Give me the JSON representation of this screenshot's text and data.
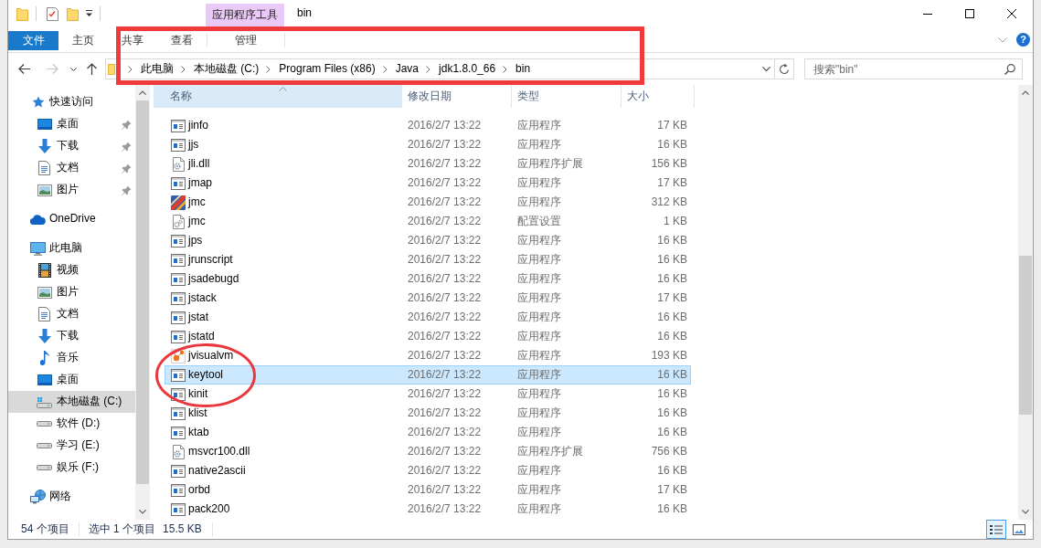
{
  "title_bar": {
    "context_tab": "应用程序工具",
    "title": "bin"
  },
  "ribbon": {
    "tabs": [
      {
        "label": "文件",
        "kind": "menu",
        "selected": false
      },
      {
        "label": "主页",
        "kind": "tab",
        "selected": false
      },
      {
        "label": "共享",
        "kind": "tab",
        "selected": false
      },
      {
        "label": "查看",
        "kind": "tab",
        "selected": false
      },
      {
        "label": "管理",
        "kind": "context",
        "selected": false
      }
    ],
    "help": "?"
  },
  "navigation": [
    {
      "kind": "back",
      "disabled": false
    },
    {
      "kind": "forward",
      "disabled": true
    },
    {
      "kind": "recent",
      "disabled": false
    },
    {
      "kind": "up",
      "disabled": false
    }
  ],
  "address_bar": {
    "crumbs": [
      "此电脑",
      "本地磁盘 (C:)",
      "Program Files (x86)",
      "Java",
      "jdk1.8.0_66",
      "bin"
    ]
  },
  "search": {
    "placeholder": "搜索\"bin\""
  },
  "sidebar": {
    "items": [
      {
        "label": "快速访问",
        "kind": "quick-access",
        "selected": false,
        "children": [
          {
            "label": "桌面",
            "kind": "desktop",
            "selected": false,
            "pinned": true
          },
          {
            "label": "下载",
            "kind": "downloads",
            "selected": false,
            "pinned": true
          },
          {
            "label": "文档",
            "kind": "documents",
            "selected": false,
            "pinned": true
          },
          {
            "label": "图片",
            "kind": "pictures",
            "selected": false,
            "pinned": true
          }
        ]
      },
      {
        "label": "OneDrive",
        "kind": "onedrive",
        "selected": false
      },
      {
        "label": "此电脑",
        "kind": "computer",
        "selected": false,
        "children": [
          {
            "label": "视频",
            "kind": "videos",
            "selected": false
          },
          {
            "label": "图片",
            "kind": "pictures",
            "selected": false
          },
          {
            "label": "文档",
            "kind": "documents",
            "selected": false
          },
          {
            "label": "下载",
            "kind": "downloads",
            "selected": false
          },
          {
            "label": "音乐",
            "kind": "music",
            "selected": false
          },
          {
            "label": "桌面",
            "kind": "desktop",
            "selected": false
          },
          {
            "label": "本地磁盘 (C:)",
            "kind": "system-drive",
            "selected": true
          },
          {
            "label": "软件 (D:)",
            "kind": "drive",
            "selected": false
          },
          {
            "label": "学习 (E:)",
            "kind": "drive",
            "selected": false
          },
          {
            "label": "娱乐 (F:)",
            "kind": "drive",
            "selected": false
          }
        ]
      },
      {
        "label": "网络",
        "kind": "network",
        "selected": false
      }
    ]
  },
  "columns": [
    {
      "label": "名称",
      "sorted": true
    },
    {
      "label": "修改日期",
      "sorted": false
    },
    {
      "label": "类型",
      "sorted": false
    },
    {
      "label": "大小",
      "sorted": false
    }
  ],
  "files": [
    {
      "name": "jinfo",
      "kind": "exe",
      "date": "2016/2/7 13:22",
      "type": "应用程序",
      "size": "17 KB",
      "selected": false
    },
    {
      "name": "jjs",
      "kind": "exe",
      "date": "2016/2/7 13:22",
      "type": "应用程序",
      "size": "16 KB",
      "selected": false
    },
    {
      "name": "jli.dll",
      "kind": "dll",
      "date": "2016/2/7 13:22",
      "type": "应用程序扩展",
      "size": "156 KB",
      "selected": false
    },
    {
      "name": "jmap",
      "kind": "exe",
      "date": "2016/2/7 13:22",
      "type": "应用程序",
      "size": "17 KB",
      "selected": false
    },
    {
      "name": "jmc",
      "kind": "jmc",
      "date": "2016/2/7 13:22",
      "type": "应用程序",
      "size": "312 KB",
      "selected": false
    },
    {
      "name": "jmc",
      "kind": "ini",
      "date": "2016/2/7 13:22",
      "type": "配置设置",
      "size": "1 KB",
      "selected": false
    },
    {
      "name": "jps",
      "kind": "exe",
      "date": "2016/2/7 13:22",
      "type": "应用程序",
      "size": "16 KB",
      "selected": false
    },
    {
      "name": "jrunscript",
      "kind": "exe",
      "date": "2016/2/7 13:22",
      "type": "应用程序",
      "size": "16 KB",
      "selected": false
    },
    {
      "name": "jsadebugd",
      "kind": "exe",
      "date": "2016/2/7 13:22",
      "type": "应用程序",
      "size": "16 KB",
      "selected": false
    },
    {
      "name": "jstack",
      "kind": "exe",
      "date": "2016/2/7 13:22",
      "type": "应用程序",
      "size": "17 KB",
      "selected": false
    },
    {
      "name": "jstat",
      "kind": "exe",
      "date": "2016/2/7 13:22",
      "type": "应用程序",
      "size": "16 KB",
      "selected": false
    },
    {
      "name": "jstatd",
      "kind": "exe",
      "date": "2016/2/7 13:22",
      "type": "应用程序",
      "size": "16 KB",
      "selected": false
    },
    {
      "name": "jvisualvm",
      "kind": "visualvm",
      "date": "2016/2/7 13:22",
      "type": "应用程序",
      "size": "193 KB",
      "selected": false
    },
    {
      "name": "keytool",
      "kind": "exe",
      "date": "2016/2/7 13:22",
      "type": "应用程序",
      "size": "16 KB",
      "selected": true
    },
    {
      "name": "kinit",
      "kind": "exe",
      "date": "2016/2/7 13:22",
      "type": "应用程序",
      "size": "16 KB",
      "selected": false
    },
    {
      "name": "klist",
      "kind": "exe",
      "date": "2016/2/7 13:22",
      "type": "应用程序",
      "size": "16 KB",
      "selected": false
    },
    {
      "name": "ktab",
      "kind": "exe",
      "date": "2016/2/7 13:22",
      "type": "应用程序",
      "size": "16 KB",
      "selected": false
    },
    {
      "name": "msvcr100.dll",
      "kind": "dll",
      "date": "2016/2/7 13:22",
      "type": "应用程序扩展",
      "size": "756 KB",
      "selected": false
    },
    {
      "name": "native2ascii",
      "kind": "exe",
      "date": "2016/2/7 13:22",
      "type": "应用程序",
      "size": "16 KB",
      "selected": false
    },
    {
      "name": "orbd",
      "kind": "exe",
      "date": "2016/2/7 13:22",
      "type": "应用程序",
      "size": "17 KB",
      "selected": false
    },
    {
      "name": "pack200",
      "kind": "exe",
      "date": "2016/2/7 13:22",
      "type": "应用程序",
      "size": "16 KB",
      "selected": false
    }
  ],
  "status_bar": {
    "item_count": "54 个项目",
    "selection": "选中 1 个项目",
    "selection_size": "15.5 KB",
    "views": [
      {
        "kind": "details",
        "selected": true
      },
      {
        "kind": "large-icons",
        "selected": false
      }
    ]
  },
  "annotations": [
    {
      "kind": "rectangle"
    },
    {
      "kind": "ellipse"
    }
  ]
}
